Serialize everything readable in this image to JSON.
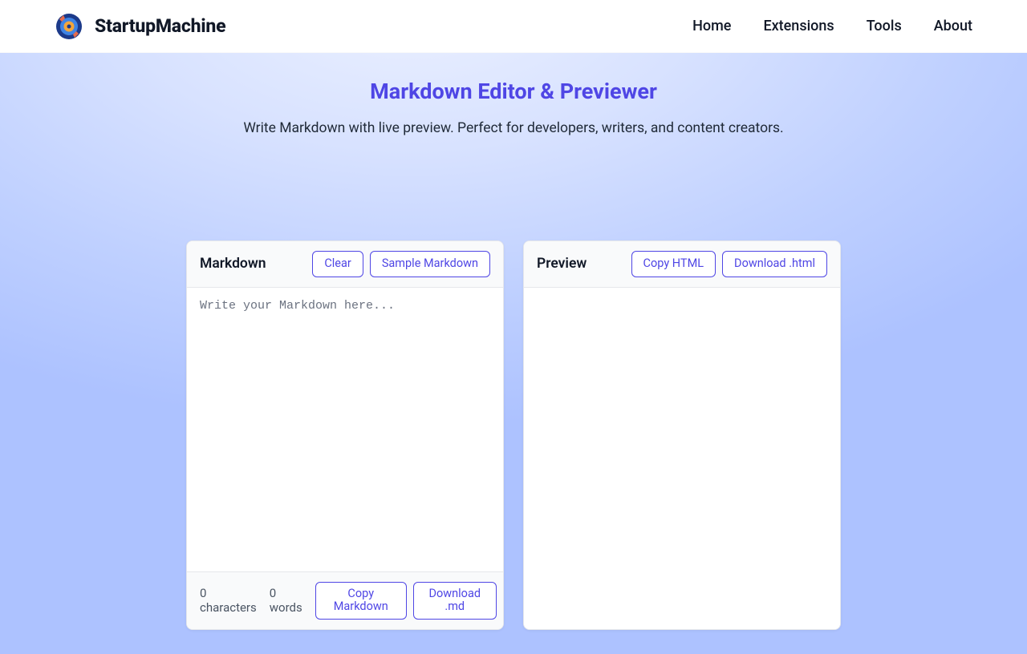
{
  "brand": {
    "name": "StartupMachine"
  },
  "nav": {
    "home": "Home",
    "extensions": "Extensions",
    "tools": "Tools",
    "about": "About"
  },
  "page": {
    "title": "Markdown Editor & Previewer",
    "subtitle": "Write Markdown with live preview. Perfect for developers, writers, and content creators."
  },
  "editor": {
    "panel_title": "Markdown",
    "clear_label": "Clear",
    "sample_label": "Sample Markdown",
    "placeholder": "Write your Markdown here...",
    "value": "",
    "char_count_value": "0",
    "char_count_label": "characters",
    "word_count_value": "0",
    "word_count_label": "words",
    "copy_md_label": "Copy Markdown",
    "download_md_label": "Download .md"
  },
  "preview": {
    "panel_title": "Preview",
    "copy_html_label": "Copy HTML",
    "download_html_label": "Download .html"
  }
}
